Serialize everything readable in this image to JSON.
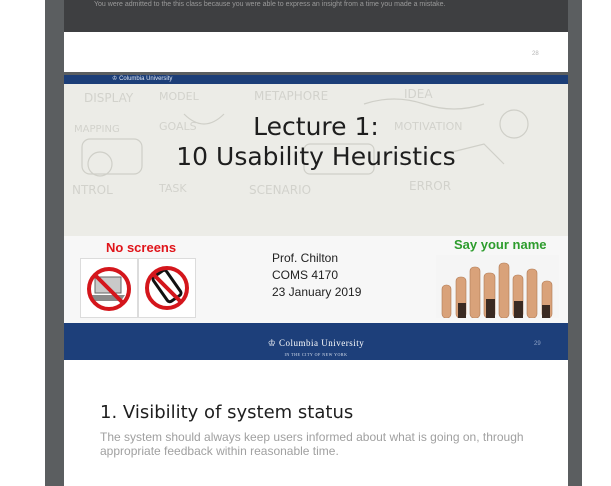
{
  "slide28": {
    "caption": "You were admitted to the this class because you were able to express an insight from a time you made a mistake.",
    "number": "28"
  },
  "slide29": {
    "header_logo": "Columbia University",
    "title_line1": "Lecture 1:",
    "title_line2": "10 Usability Heuristics",
    "no_screens": "No screens",
    "prof": "Prof. Chilton",
    "course": "COMS 4170",
    "date": "23 January 2019",
    "say_your_name": "Say your name",
    "footer_logo_main": "Columbia University",
    "footer_logo_sub": "IN THE CITY OF NEW YORK",
    "number": "29"
  },
  "slide30": {
    "title": "1. Visibility of system status",
    "body": "The system should always keep users informed about what is going on, through appropriate feedback within reasonable time."
  },
  "colors": {
    "columbia_blue": "#1d3f7a",
    "no_screens_red": "#e0141a",
    "say_name_green": "#2d9c2d",
    "viewer_gray": "#5b5e60"
  },
  "icons": {
    "crown": "crown-icon",
    "no_laptop": "no-laptop-icon",
    "no_phone": "no-phone-icon",
    "raised_hands": "raised-hands-image"
  }
}
